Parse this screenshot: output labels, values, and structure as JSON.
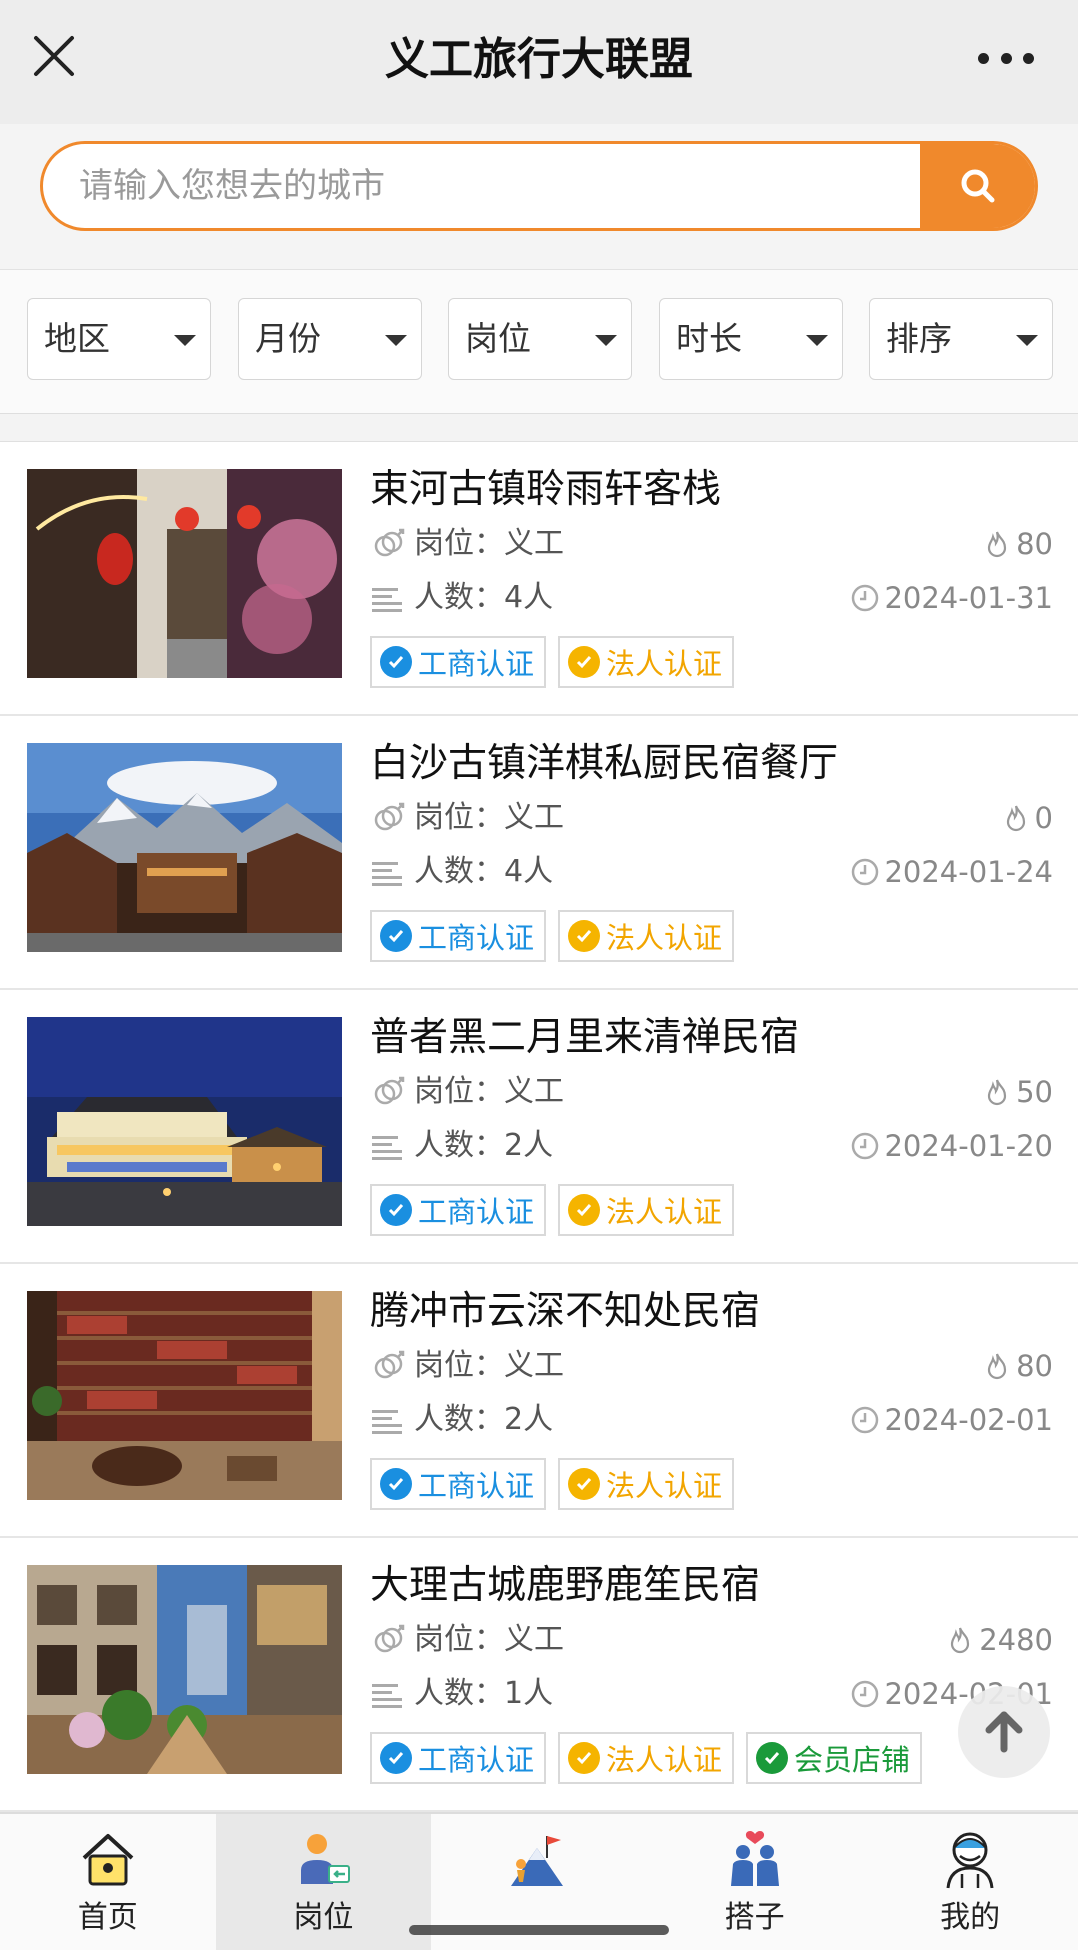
{
  "header": {
    "title": "义工旅行大联盟",
    "close_icon": "close-icon",
    "more_icon": "more-dots-icon"
  },
  "search": {
    "placeholder": "请输入您想去的城市",
    "value": "",
    "button_icon": "search-icon",
    "accent": "#f0892c"
  },
  "filters": [
    {
      "label": "地区"
    },
    {
      "label": "月份"
    },
    {
      "label": "岗位"
    },
    {
      "label": "时长"
    },
    {
      "label": "排序"
    }
  ],
  "listings": [
    {
      "name": "束河古镇聆雨轩客栈",
      "role": "岗位：义工",
      "count": "人数：4人",
      "heat": "80",
      "date": "2024-01-31",
      "badges": [
        "工商认证",
        "法人认证"
      ]
    },
    {
      "name": "白沙古镇洋棋私厨民宿餐厅",
      "role": "岗位：义工",
      "count": "人数：4人",
      "heat": "0",
      "date": "2024-01-24",
      "badges": [
        "工商认证",
        "法人认证"
      ]
    },
    {
      "name": "普者黑二月里来清禅民宿",
      "role": "岗位：义工",
      "count": "人数：2人",
      "heat": "50",
      "date": "2024-01-20",
      "badges": [
        "工商认证",
        "法人认证"
      ]
    },
    {
      "name": "腾冲市云深不知处民宿",
      "role": "岗位：义工",
      "count": "人数：2人",
      "heat": "80",
      "date": "2024-02-01",
      "badges": [
        "工商认证",
        "法人认证"
      ]
    },
    {
      "name": "大理古城鹿野鹿笙民宿",
      "role": "岗位：义工",
      "count": "人数：1人",
      "heat": "2480",
      "date": "2024-02-01",
      "badges": [
        "工商认证",
        "法人认证",
        "会员店铺"
      ]
    }
  ],
  "tabs": [
    {
      "label": "首页",
      "icon": "home-icon"
    },
    {
      "label": "岗位",
      "icon": "job-icon",
      "active": true
    },
    {
      "label": "",
      "icon": "mountain-flag-icon"
    },
    {
      "label": "搭子",
      "icon": "partners-icon"
    },
    {
      "label": "我的",
      "icon": "profile-icon"
    }
  ],
  "colors": {
    "badge_blue": "#1a8fe0",
    "badge_yellow": "#f5b400",
    "badge_green": "#1a9a3a"
  }
}
